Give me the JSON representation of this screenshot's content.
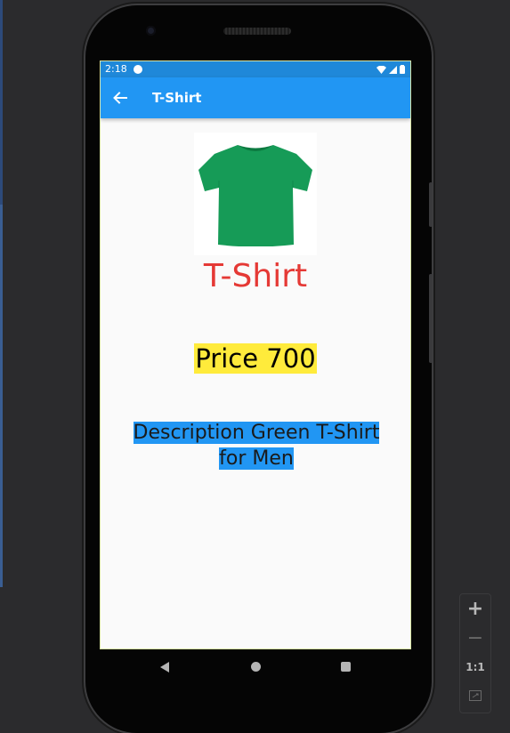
{
  "status_bar": {
    "time": "2:18"
  },
  "app_bar": {
    "title": "T-Shirt"
  },
  "product": {
    "image": {
      "color": "#169b57"
    },
    "name": "T-Shirt",
    "price_text": "Price 700",
    "description_text": "Description Green T-Shirt for Men"
  },
  "colors": {
    "app_bar": "#2196f3",
    "title_text": "#e53935",
    "price_highlight": "#ffeb3b",
    "description_highlight": "#2196f3"
  },
  "navigation": {
    "buttons": [
      "back-icon",
      "home-icon",
      "recents-icon"
    ]
  },
  "emulator_controls": {
    "zoom_in": "+",
    "zoom_out": "−",
    "actual_size": "1:1"
  }
}
